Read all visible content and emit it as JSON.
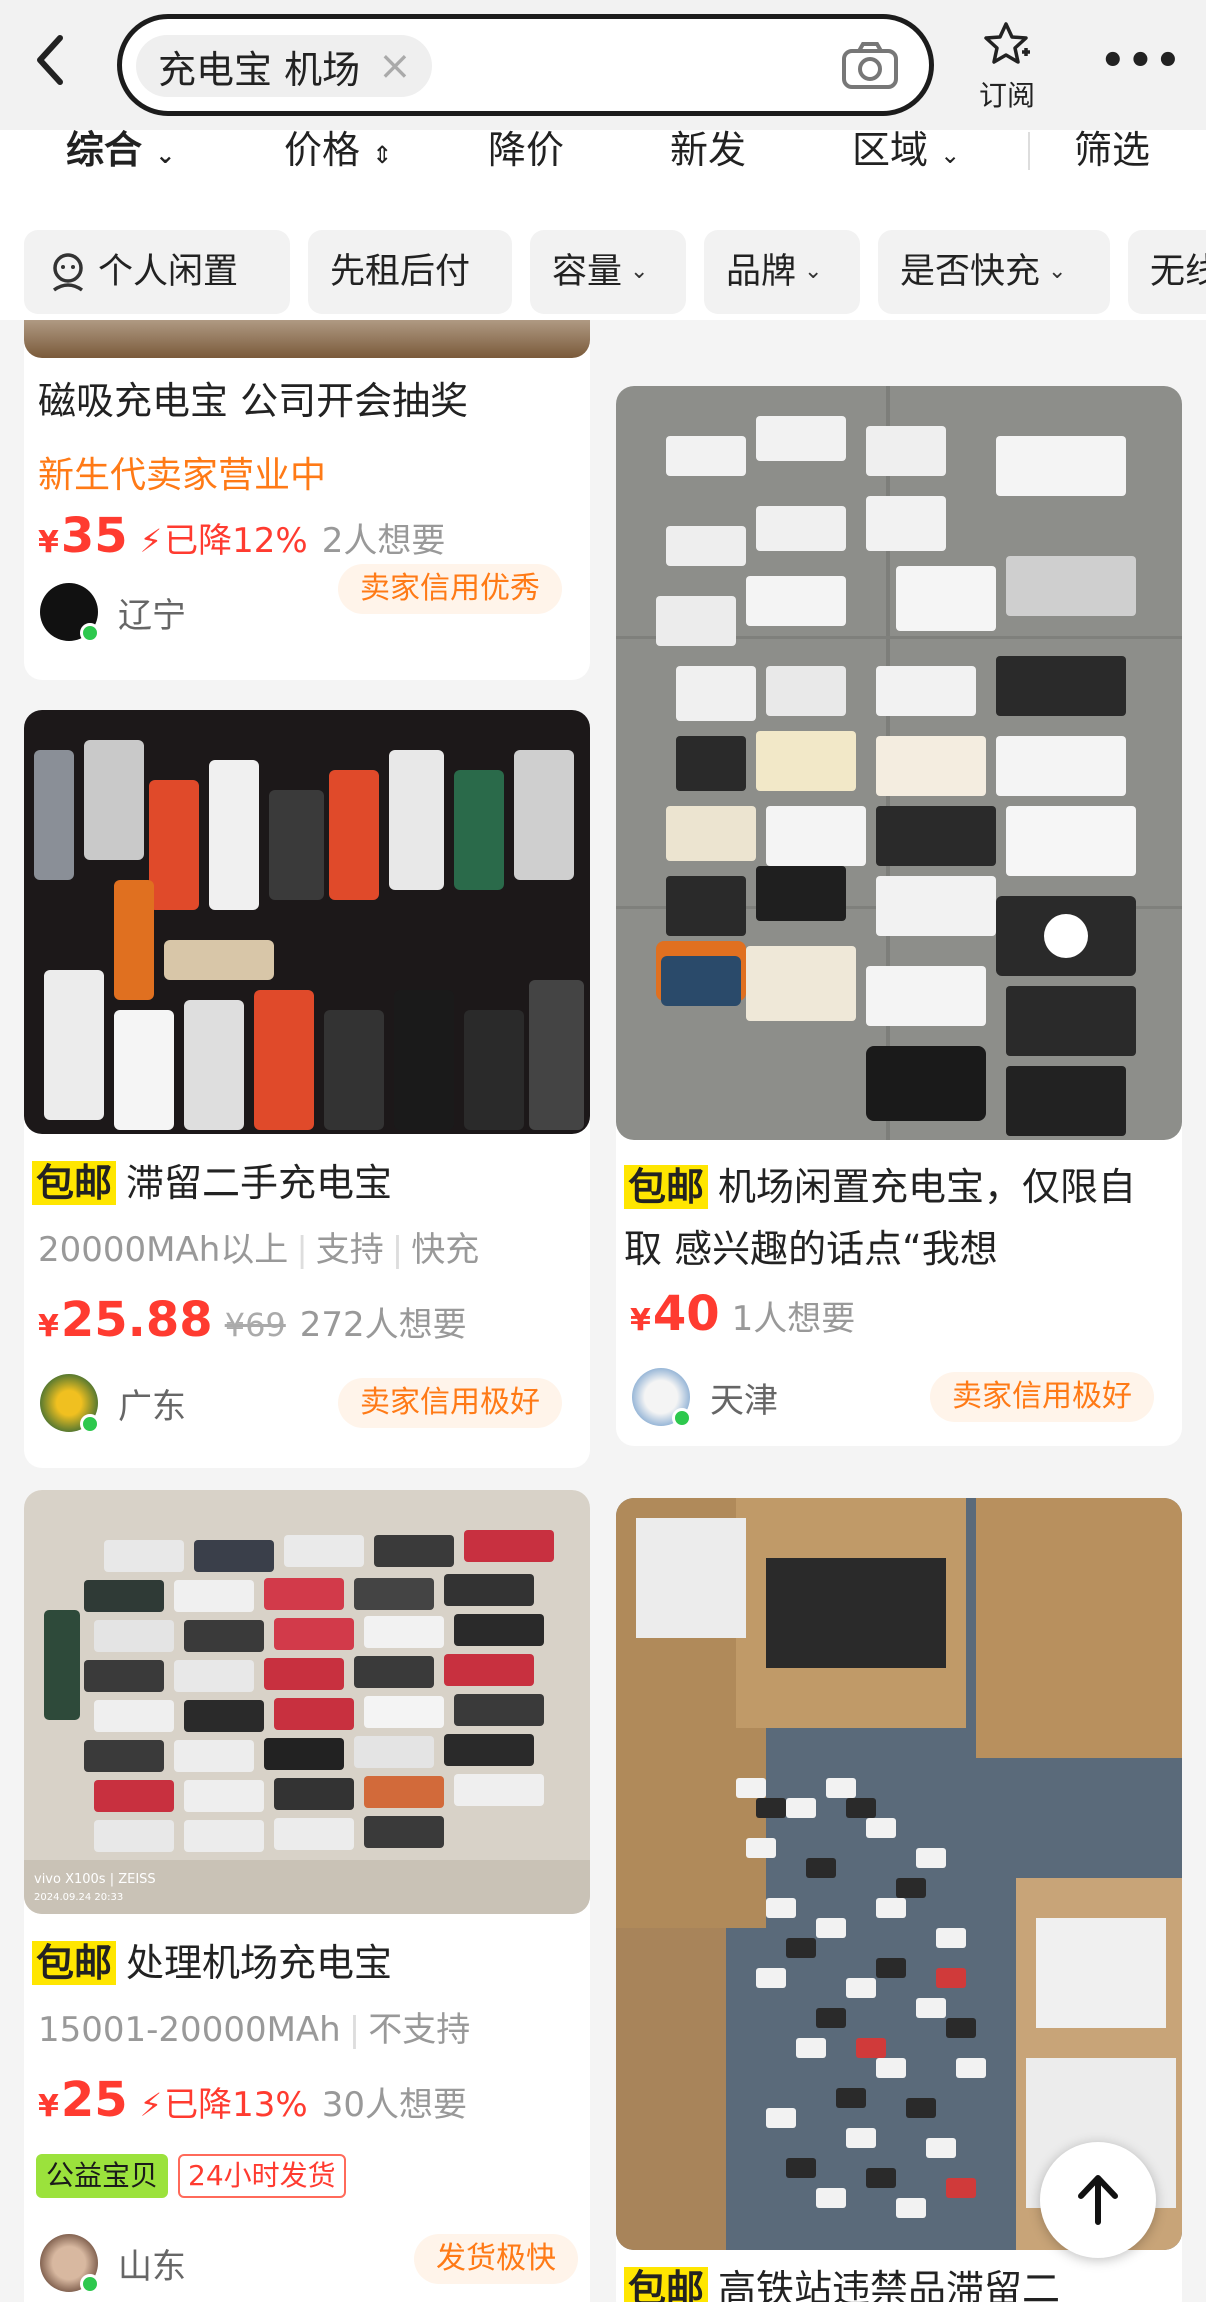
{
  "search": {
    "query": "充电宝 机场"
  },
  "header": {
    "subscribe_label": "订阅"
  },
  "sort_tabs": [
    {
      "label": "综合"
    },
    {
      "label": "价格"
    },
    {
      "label": "降价"
    },
    {
      "label": "新发"
    },
    {
      "label": "区域"
    },
    {
      "label": "筛选"
    }
  ],
  "filters": [
    {
      "label": "个人闲置"
    },
    {
      "label": "先租后付"
    },
    {
      "label": "容量"
    },
    {
      "label": "品牌"
    },
    {
      "label": "是否快充"
    },
    {
      "label": "无线"
    }
  ],
  "items": [
    {
      "title": "磁吸充电宝 公司开会抽奖",
      "seller_note": "新生代卖家营业中",
      "price": "35",
      "drop": "已降12%",
      "wants": "2人想要",
      "region": "辽宁",
      "credit": "卖家信用优秀"
    },
    {
      "tag": "包邮",
      "title": "滞留二手充电宝",
      "attrs": [
        "20000MAh以上",
        "支持",
        "快充"
      ],
      "price": "25.88",
      "orig_price": "¥69",
      "wants": "272人想要",
      "region": "广东",
      "credit": "卖家信用极好"
    },
    {
      "tag": "包邮",
      "title": "机场闲置充电宝，仅限自取 感兴趣的话点“我想",
      "price": "40",
      "wants": "1人想要",
      "region": "天津",
      "credit": "卖家信用极好"
    },
    {
      "tag": "包邮",
      "title": "处理机场充电宝",
      "attrs": [
        "15001-20000MAh",
        "不支持"
      ],
      "price": "25",
      "drop": "已降13%",
      "wants": "30人想要",
      "badge_green": "公益宝贝",
      "badge_red": "24小时发货",
      "region": "山东",
      "credit": "发货极快"
    },
    {
      "tag": "包邮",
      "title": "高铁站违禁品滞留二"
    }
  ],
  "photo_caption": "vivo X100s | ZEISS",
  "photo_date": "2024.09.24 20:33"
}
